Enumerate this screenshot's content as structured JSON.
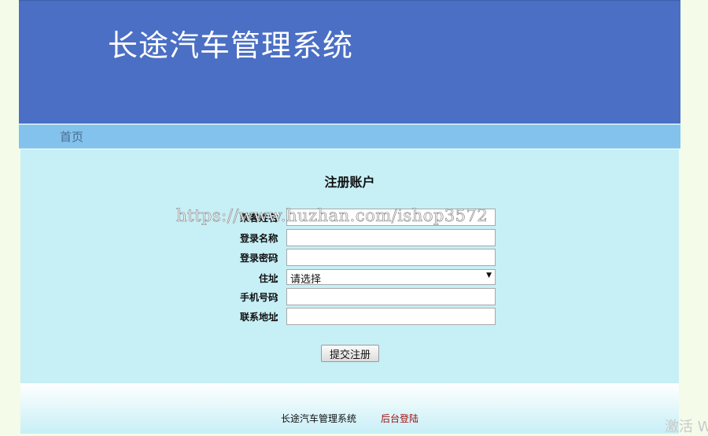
{
  "header": {
    "title": "长途汽车管理系统"
  },
  "nav": {
    "home": "首页"
  },
  "form": {
    "title": "注册账户",
    "colon": "：",
    "fields": [
      {
        "label": "乘客姓名",
        "value": ""
      },
      {
        "label": "登录名称",
        "value": ""
      },
      {
        "label": "登录密码",
        "value": ""
      },
      {
        "label": "住址",
        "value": "请选择"
      },
      {
        "label": "手机号码",
        "value": ""
      },
      {
        "label": "联系地址",
        "value": ""
      }
    ],
    "submit": "提交注册"
  },
  "footer": {
    "text": "长途汽车管理系统",
    "link": "后台登陆"
  },
  "overlay": {
    "watermark": "https://www.huzhan.com/ishop3572",
    "activate": "激活 W"
  },
  "colors": {
    "header_bg": "#4a6fc4",
    "nav_bg": "#82c2ec",
    "content_bg": "#c7eff6",
    "footer_link": "#a01010"
  }
}
